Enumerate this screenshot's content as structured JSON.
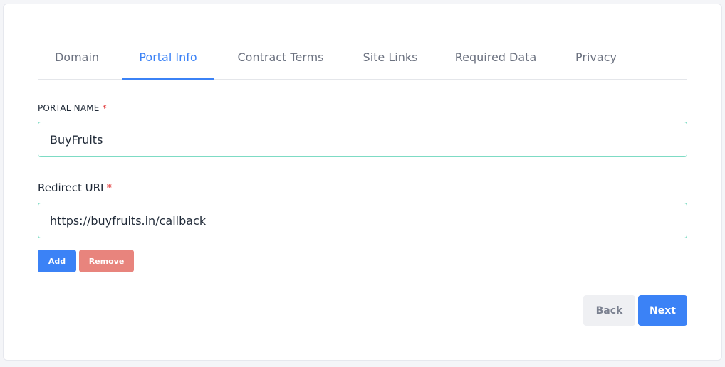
{
  "tabs": [
    {
      "label": "Domain",
      "active": false
    },
    {
      "label": "Portal Info",
      "active": true
    },
    {
      "label": "Contract Terms",
      "active": false
    },
    {
      "label": "Site Links",
      "active": false
    },
    {
      "label": "Required Data",
      "active": false
    },
    {
      "label": "Privacy",
      "active": false
    }
  ],
  "portal_name": {
    "label": "PORTAL NAME",
    "required_marker": "*",
    "value": "BuyFruits"
  },
  "redirect_uri": {
    "label": "Redirect URI",
    "required_marker": "*",
    "value": "https://buyfruits.in/callback"
  },
  "uri_actions": {
    "add_label": "Add",
    "remove_label": "Remove"
  },
  "footer": {
    "back_label": "Back",
    "next_label": "Next"
  },
  "colors": {
    "accent": "#3b82f6",
    "remove": "#e8847d",
    "input_border": "#7ddbc4",
    "required": "#e03131"
  }
}
